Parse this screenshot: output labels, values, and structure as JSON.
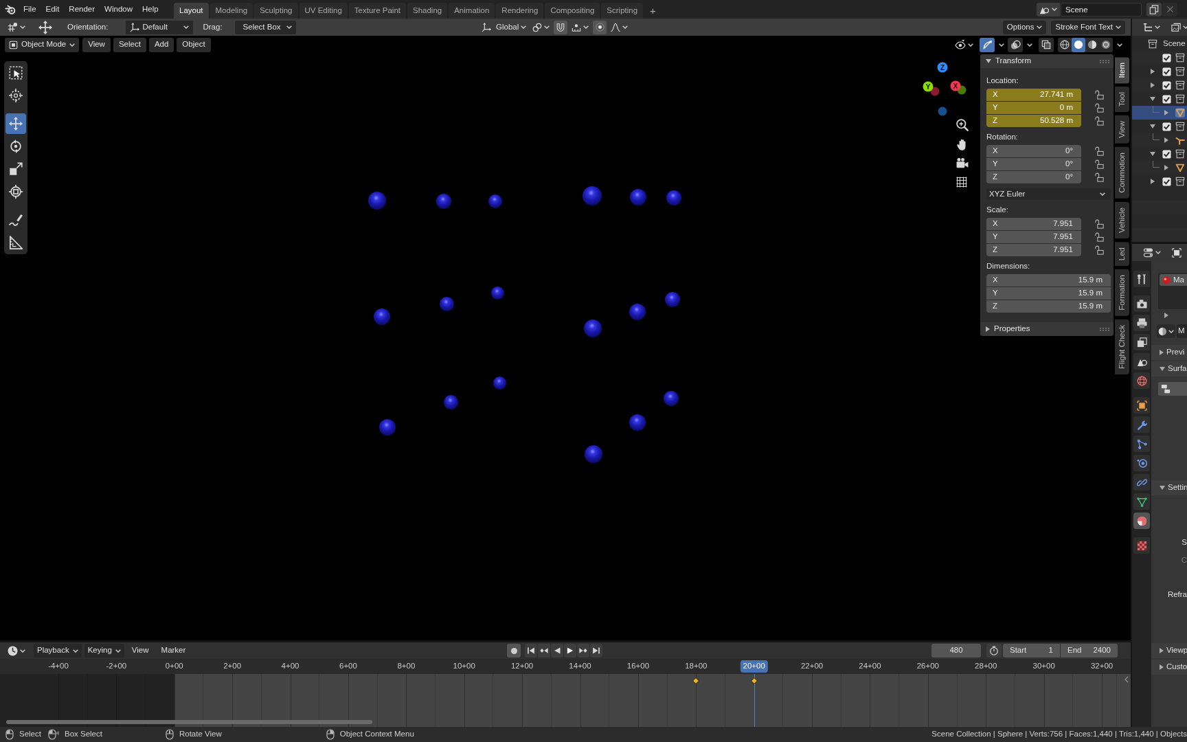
{
  "topbar": {
    "menus": [
      "File",
      "Edit",
      "Render",
      "Window",
      "Help"
    ],
    "workspaces": [
      {
        "label": "Layout",
        "selected": true
      },
      {
        "label": "Modeling",
        "selected": false
      },
      {
        "label": "Sculpting",
        "selected": false
      },
      {
        "label": "UV Editing",
        "selected": false
      },
      {
        "label": "Texture Paint",
        "selected": false
      },
      {
        "label": "Shading",
        "selected": false
      },
      {
        "label": "Animation",
        "selected": false
      },
      {
        "label": "Rendering",
        "selected": false
      },
      {
        "label": "Compositing",
        "selected": false
      },
      {
        "label": "Scripting",
        "selected": false
      }
    ],
    "add_workspace": "+",
    "scene": "Scene"
  },
  "tool_settings": {
    "orientation_label": "Orientation:",
    "orientation": "Default",
    "drag_label": "Drag:",
    "drag": "Select Box",
    "transform_orientation": "Global",
    "options": "Options",
    "font": "Stroke Font Text"
  },
  "viewport": {
    "mode": "Object Mode",
    "menus": [
      "View",
      "Select",
      "Add",
      "Object"
    ],
    "gizmos": true,
    "shading": [
      {
        "kind": "wireframe",
        "selected": false
      },
      {
        "kind": "solid",
        "selected": true
      },
      {
        "kind": "material",
        "selected": false
      },
      {
        "kind": "rendered",
        "selected": false
      }
    ],
    "tools": [
      {
        "kind": "select_box",
        "selected": false
      },
      {
        "kind": "cursor",
        "selected": false
      },
      {
        "kind": "move",
        "selected": true
      },
      {
        "kind": "rotate",
        "selected": false
      },
      {
        "kind": "scale",
        "selected": false
      },
      {
        "kind": "transform",
        "selected": false
      },
      {
        "kind": "annotate",
        "selected": false
      },
      {
        "kind": "measure",
        "selected": false
      }
    ],
    "axes": [
      {
        "label": "X",
        "color": "#ff3352"
      },
      {
        "label": "Y",
        "color": "#8bdc00"
      },
      {
        "label": "Z",
        "color": "#2890ff"
      }
    ],
    "objects": [
      {
        "kind": "sphere"
      },
      {
        "kind": "sphere"
      },
      {
        "kind": "sphere"
      },
      {
        "kind": "sphere"
      },
      {
        "kind": "sphere"
      },
      {
        "kind": "sphere"
      },
      {
        "kind": "sphere"
      },
      {
        "kind": "sphere"
      },
      {
        "kind": "sphere"
      },
      {
        "kind": "sphere"
      },
      {
        "kind": "sphere"
      },
      {
        "kind": "sphere"
      },
      {
        "kind": "sphere"
      },
      {
        "kind": "sphere"
      },
      {
        "kind": "sphere"
      },
      {
        "kind": "sphere"
      },
      {
        "kind": "sphere"
      },
      {
        "kind": "sphere"
      }
    ]
  },
  "sidebar": {
    "tabs": [
      {
        "label": "Item",
        "selected": true
      },
      {
        "label": "Tool",
        "selected": false
      },
      {
        "label": "View",
        "selected": false
      },
      {
        "label": "Commotion",
        "selected": false
      },
      {
        "label": "Vehicle",
        "selected": false
      },
      {
        "label": "Led",
        "selected": false
      },
      {
        "label": "Formation",
        "selected": false
      },
      {
        "label": "Flight Check",
        "selected": false
      }
    ],
    "transform": {
      "title": "Transform",
      "expanded": true,
      "rows": [
        {
          "kind": "label",
          "text": "Location:"
        },
        {
          "kind": "vector",
          "fields": [
            {
              "axis": "X",
              "value": "27.741 m",
              "animated": true,
              "locked": false
            },
            {
              "axis": "Y",
              "value": "0 m",
              "animated": true,
              "locked": false
            },
            {
              "axis": "Z",
              "value": "50.528 m",
              "animated": true,
              "locked": false
            }
          ]
        },
        {
          "kind": "label",
          "text": "Rotation:"
        },
        {
          "kind": "vector",
          "fields": [
            {
              "axis": "X",
              "value": "0°",
              "animated": false,
              "locked": false
            },
            {
              "axis": "Y",
              "value": "0°",
              "animated": false,
              "locked": false
            },
            {
              "axis": "Z",
              "value": "0°",
              "animated": false,
              "locked": false
            }
          ]
        },
        {
          "kind": "dropdown",
          "value": "XYZ Euler"
        },
        {
          "kind": "label",
          "text": "Scale:"
        },
        {
          "kind": "vector",
          "fields": [
            {
              "axis": "X",
              "value": "7.951",
              "animated": false,
              "locked": false
            },
            {
              "axis": "Y",
              "value": "7.951",
              "animated": false,
              "locked": false
            },
            {
              "axis": "Z",
              "value": "7.951",
              "animated": false,
              "locked": false
            }
          ]
        },
        {
          "kind": "label",
          "text": "Dimensions:"
        },
        {
          "kind": "vector",
          "fields": [
            {
              "axis": "X",
              "value": "15.9 m",
              "animated": false
            },
            {
              "axis": "Y",
              "value": "15.9 m",
              "animated": false
            },
            {
              "axis": "Z",
              "value": "15.9 m",
              "animated": false
            }
          ]
        }
      ]
    },
    "properties": {
      "title": "Properties",
      "expanded": false
    }
  },
  "outliner": {
    "root": "Scene",
    "items": [
      {
        "kind": "collection",
        "checked": true,
        "selected": false
      },
      {
        "kind": "collection",
        "checked": true,
        "expanded": false,
        "selected": false
      },
      {
        "kind": "collection",
        "checked": true,
        "expanded": false,
        "selected": false
      },
      {
        "kind": "collection",
        "checked": true,
        "expanded": true,
        "selected": false,
        "children": [
          {
            "kind": "mesh",
            "expanded": false,
            "selected": true
          }
        ]
      },
      {
        "kind": "collection",
        "checked": true,
        "expanded": true,
        "selected": false,
        "children": [
          {
            "kind": "empty",
            "expanded": false,
            "selected": false
          }
        ]
      },
      {
        "kind": "collection",
        "checked": true,
        "expanded": true,
        "selected": false,
        "children": [
          {
            "kind": "mesh",
            "expanded": false,
            "selected": false
          }
        ]
      },
      {
        "kind": "collection",
        "checked": true,
        "expanded": false,
        "selected": false
      }
    ]
  },
  "properties_editor": {
    "tabs": [
      {
        "kind": "tool",
        "selected": false
      },
      {
        "kind": "render",
        "selected": false
      },
      {
        "kind": "output",
        "selected": false
      },
      {
        "kind": "view_layer",
        "selected": false
      },
      {
        "kind": "scene",
        "selected": false
      },
      {
        "kind": "world",
        "selected": false
      },
      {
        "kind": "object",
        "selected": false
      },
      {
        "kind": "modifiers",
        "selected": false
      },
      {
        "kind": "particles",
        "selected": false
      },
      {
        "kind": "physics",
        "selected": false
      },
      {
        "kind": "constraints",
        "selected": false
      },
      {
        "kind": "data",
        "selected": false
      },
      {
        "kind": "material",
        "selected": true
      },
      {
        "kind": "texture",
        "selected": false
      }
    ],
    "slots": [
      {
        "name": "Ma",
        "selected": true
      }
    ],
    "material": "M",
    "panels": [
      {
        "title": "Previ",
        "expanded": false
      },
      {
        "title": "Surfa",
        "expanded": true,
        "rows": [
          {
            "kind": "node_button"
          }
        ]
      },
      {
        "title": "Settin",
        "expanded": true,
        "rows": [
          {
            "kind": "label",
            "text": "S",
            "disabled": false
          },
          {
            "kind": "label",
            "text": "C",
            "disabled": true
          },
          {
            "kind": "label",
            "text": "Refra",
            "disabled": false
          }
        ]
      },
      {
        "title": "Viewp",
        "expanded": false
      },
      {
        "title": "Custo",
        "expanded": false
      }
    ]
  },
  "timeline": {
    "menus": [
      {
        "label": "Playback",
        "kind": "dropdown"
      },
      {
        "label": "Keying",
        "kind": "dropdown"
      },
      {
        "label": "View",
        "kind": "menu"
      },
      {
        "label": "Marker",
        "kind": "menu"
      }
    ],
    "auto_keying": false,
    "current_frame": "480",
    "start_label": "Start",
    "start": "1",
    "end_label": "End",
    "end": "2400",
    "ticks": [
      {
        "label": "-4+00",
        "in_range": false,
        "keyframe": false,
        "current": false
      },
      {
        "label": "-2+00",
        "in_range": false,
        "keyframe": false,
        "current": false
      },
      {
        "label": "0+00",
        "in_range": true,
        "keyframe": false,
        "current": false
      },
      {
        "label": "2+00",
        "in_range": true,
        "keyframe": false,
        "current": false
      },
      {
        "label": "4+00",
        "in_range": true,
        "keyframe": false,
        "current": false
      },
      {
        "label": "6+00",
        "in_range": true,
        "keyframe": false,
        "current": false
      },
      {
        "label": "8+00",
        "in_range": true,
        "keyframe": false,
        "current": false
      },
      {
        "label": "10+00",
        "in_range": true,
        "keyframe": false,
        "current": false
      },
      {
        "label": "12+00",
        "in_range": true,
        "keyframe": false,
        "current": false
      },
      {
        "label": "14+00",
        "in_range": true,
        "keyframe": false,
        "current": false
      },
      {
        "label": "16+00",
        "in_range": true,
        "keyframe": false,
        "current": false
      },
      {
        "label": "18+00",
        "in_range": true,
        "keyframe": true,
        "current": false
      },
      {
        "label": "20+00",
        "in_range": true,
        "keyframe": true,
        "current": true
      },
      {
        "label": "22+00",
        "in_range": true,
        "keyframe": false,
        "current": false
      },
      {
        "label": "24+00",
        "in_range": true,
        "keyframe": false,
        "current": false
      },
      {
        "label": "26+00",
        "in_range": true,
        "keyframe": false,
        "current": false
      },
      {
        "label": "28+00",
        "in_range": true,
        "keyframe": false,
        "current": false
      },
      {
        "label": "30+00",
        "in_range": true,
        "keyframe": false,
        "current": false
      },
      {
        "label": "32+00",
        "in_range": true,
        "keyframe": false,
        "current": false
      }
    ]
  },
  "status_bar": {
    "hints": [
      {
        "kind": "left_click",
        "text": "Select"
      },
      {
        "kind": "left_drag",
        "text": "Box Select"
      },
      {
        "kind": "middle_click",
        "text": "Rotate View"
      },
      {
        "kind": "right_click",
        "text": "Object Context Menu"
      }
    ],
    "stats": "Scene Collection | Sphere | Verts:756 | Faces:1,440 | Tris:1,440 | Objects"
  }
}
